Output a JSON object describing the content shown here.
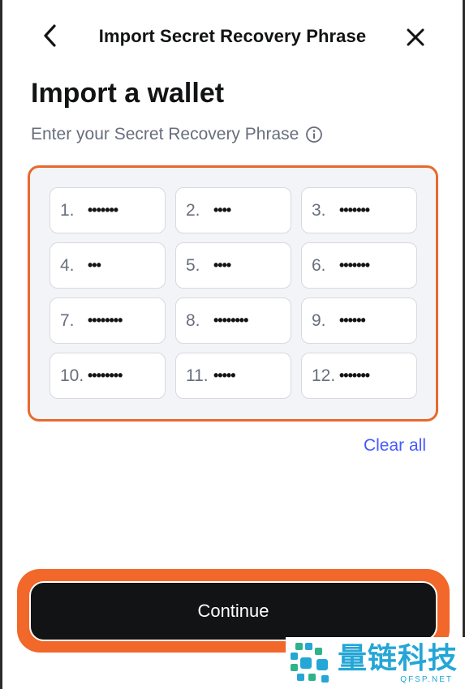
{
  "header": {
    "title": "Import Secret Recovery Phrase",
    "back_icon": "chevron-left-icon",
    "close_icon": "close-icon"
  },
  "page": {
    "title": "Import a wallet",
    "subtitle": "Enter your Secret Recovery Phrase",
    "info_icon": "info-icon"
  },
  "words": [
    {
      "index": "1.",
      "value": "•••••••"
    },
    {
      "index": "2.",
      "value": "••••"
    },
    {
      "index": "3.",
      "value": "•••••••"
    },
    {
      "index": "4.",
      "value": "•••"
    },
    {
      "index": "5.",
      "value": "••••"
    },
    {
      "index": "6.",
      "value": "•••••••"
    },
    {
      "index": "7.",
      "value": "••••••••"
    },
    {
      "index": "8.",
      "value": "••••••••"
    },
    {
      "index": "9.",
      "value": "••••••"
    },
    {
      "index": "10.",
      "value": "••••••••"
    },
    {
      "index": "11.",
      "value": "•••••"
    },
    {
      "index": "12.",
      "value": "•••••••"
    }
  ],
  "actions": {
    "clear_all": "Clear all",
    "continue": "Continue"
  },
  "watermark": {
    "cn": "量链科技",
    "en": "QFSP.NET"
  },
  "colors": {
    "accent_link": "#4459ff",
    "highlight_orange": "#e8692d",
    "button_dark": "#121314",
    "muted_text": "#686e7d"
  }
}
